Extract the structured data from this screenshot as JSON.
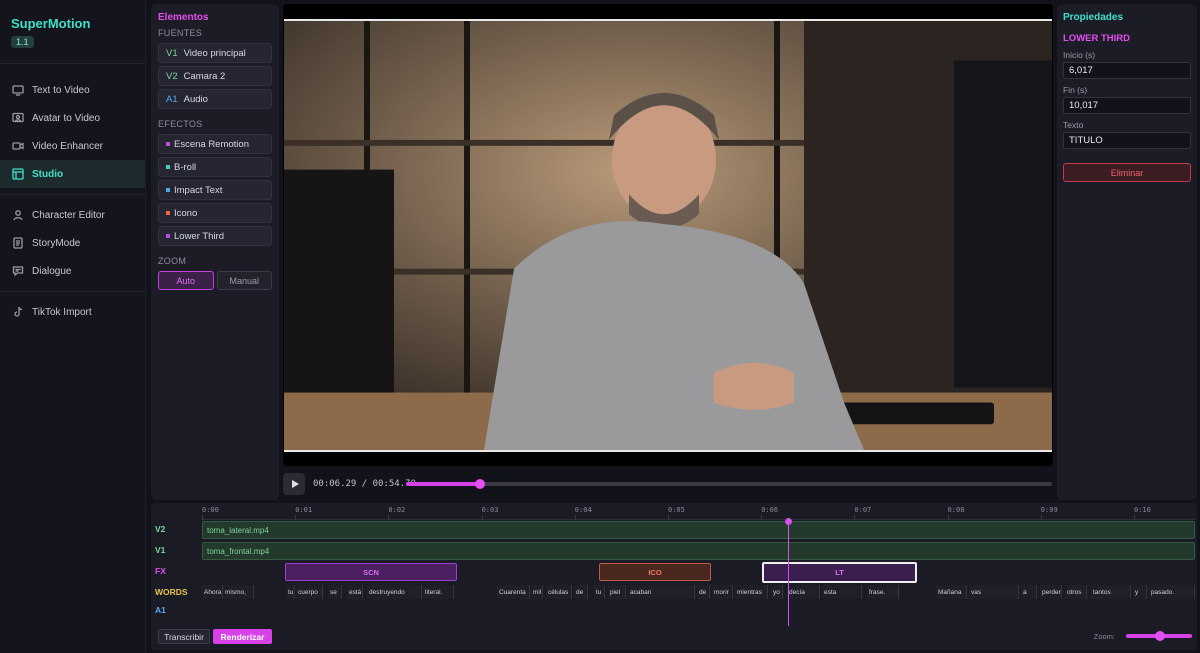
{
  "app": {
    "name": "SuperMotion",
    "version": "1.1"
  },
  "sidebar": {
    "items": [
      {
        "label": "Text to Video",
        "icon": "monitor-icon"
      },
      {
        "label": "Avatar to Video",
        "icon": "user-screen-icon"
      },
      {
        "label": "Video Enhancer",
        "icon": "video-camera-icon"
      },
      {
        "label": "Studio",
        "icon": "layout-icon",
        "active": true
      },
      {
        "label": "Character Editor",
        "icon": "person-icon"
      },
      {
        "label": "StoryMode",
        "icon": "document-icon"
      },
      {
        "label": "Dialogue",
        "icon": "chat-icon"
      },
      {
        "label": "TikTok Import",
        "icon": "tiktok-icon"
      }
    ]
  },
  "elements": {
    "title": "Elementos",
    "sources_label": "FUENTES",
    "sources": [
      {
        "tag": "V1",
        "label": "Video principal",
        "color": "#7ed49a"
      },
      {
        "tag": "V2",
        "label": "Camara 2",
        "color": "#7ed49a"
      },
      {
        "tag": "A1",
        "label": "Audio",
        "color": "#5aa8f0"
      }
    ],
    "effects_label": "EFECTOS",
    "effects": [
      {
        "label": "Escena Remotion",
        "color": "#c44ee0"
      },
      {
        "label": "B-roll",
        "color": "#3fd0c0"
      },
      {
        "label": "Impact Text",
        "color": "#4aa8f0"
      },
      {
        "label": "Icono",
        "color": "#f06a40"
      },
      {
        "label": "Lower Third",
        "color": "#b04ee0"
      }
    ],
    "zoom_label": "ZOOM",
    "zoom_auto": "Auto",
    "zoom_manual": "Manual"
  },
  "player": {
    "current": "00:06.29",
    "total": "00:54.70",
    "progress": 0.115
  },
  "properties": {
    "title": "Propiedades",
    "element": "LOWER THIRD",
    "start_label": "Inicio (s)",
    "start": "6,017",
    "end_label": "Fin (s)",
    "end": "10,017",
    "text_label": "Texto",
    "text": "TITULO",
    "delete": "Eliminar"
  },
  "timeline": {
    "ticks": [
      "0:00",
      "0:01",
      "0:02",
      "0:03",
      "0:04",
      "0:05",
      "0:06",
      "0:07",
      "0:08",
      "0:09",
      "0:10"
    ],
    "tracks": {
      "v2": "V2",
      "v1": "V1",
      "fx": "FX",
      "words": "WORDS",
      "a1": "A1"
    },
    "v2_clip": "toma_lateral.mp4",
    "v1_clip": "toma_frontal.mp4",
    "fx_clips": [
      {
        "label": "SCN",
        "color": "#c44ee0"
      },
      {
        "label": "ICO",
        "color": "#f06a40"
      },
      {
        "label": "LT",
        "color": "#ffffff"
      }
    ],
    "words": [
      "Ahora",
      "mismo,",
      "tu",
      "cuerpo",
      "se",
      "está",
      "destruyendo",
      "literal.",
      "Cuarenta",
      "mil",
      "células",
      "de",
      "tu",
      "piel",
      "acaban",
      "de",
      "morir",
      "mientras",
      "yo",
      "decía",
      "esta",
      "frase.",
      "Mañana",
      "vas",
      "a",
      "perder",
      "otros",
      "tantos",
      "y",
      "pasado."
    ],
    "transcribe": "Transcribir",
    "render": "Renderizar",
    "zoom_label": "Zoom:"
  }
}
